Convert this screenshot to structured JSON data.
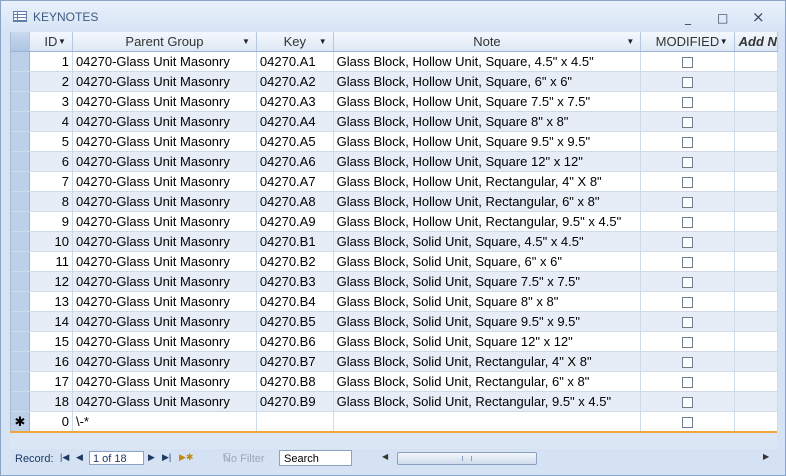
{
  "window": {
    "title": "KEYNOTES",
    "minimize": "_",
    "maximize": "□",
    "close": "×"
  },
  "columns": {
    "id": "ID",
    "parent_group": "Parent Group",
    "key": "Key",
    "note": "Note",
    "modified": "MODIFIED",
    "add": "Add N"
  },
  "rows": [
    {
      "id": "1",
      "group": "04270-Glass Unit Masonry",
      "key": "04270.A1",
      "note": "Glass Block, Hollow Unit, Square, 4.5\" x 4.5\""
    },
    {
      "id": "2",
      "group": "04270-Glass Unit Masonry",
      "key": "04270.A2",
      "note": "Glass Block, Hollow Unit, Square, 6\" x 6\""
    },
    {
      "id": "3",
      "group": "04270-Glass Unit Masonry",
      "key": "04270.A3",
      "note": "Glass Block, Hollow Unit, Square 7.5\" x 7.5\""
    },
    {
      "id": "4",
      "group": "04270-Glass Unit Masonry",
      "key": "04270.A4",
      "note": "Glass Block, Hollow Unit, Square 8\" x 8\""
    },
    {
      "id": "5",
      "group": "04270-Glass Unit Masonry",
      "key": "04270.A5",
      "note": "Glass Block, Hollow Unit, Square 9.5\" x 9.5\""
    },
    {
      "id": "6",
      "group": "04270-Glass Unit Masonry",
      "key": "04270.A6",
      "note": "Glass Block, Hollow Unit, Square 12\" x 12\""
    },
    {
      "id": "7",
      "group": "04270-Glass Unit Masonry",
      "key": "04270.A7",
      "note": "Glass Block, Hollow Unit, Rectangular, 4\" X 8\""
    },
    {
      "id": "8",
      "group": "04270-Glass Unit Masonry",
      "key": "04270.A8",
      "note": "Glass Block, Hollow Unit, Rectangular, 6\" x 8\""
    },
    {
      "id": "9",
      "group": "04270-Glass Unit Masonry",
      "key": "04270.A9",
      "note": "Glass Block, Hollow Unit, Rectangular, 9.5\" x 4.5\""
    },
    {
      "id": "10",
      "group": "04270-Glass Unit Masonry",
      "key": "04270.B1",
      "note": "Glass Block, Solid Unit, Square, 4.5\" x 4.5\""
    },
    {
      "id": "11",
      "group": "04270-Glass Unit Masonry",
      "key": "04270.B2",
      "note": "Glass Block, Solid Unit, Square, 6\" x 6\""
    },
    {
      "id": "12",
      "group": "04270-Glass Unit Masonry",
      "key": "04270.B3",
      "note": "Glass Block, Solid Unit, Square 7.5\" x 7.5\""
    },
    {
      "id": "13",
      "group": "04270-Glass Unit Masonry",
      "key": "04270.B4",
      "note": "Glass Block, Solid Unit, Square 8\" x 8\""
    },
    {
      "id": "14",
      "group": "04270-Glass Unit Masonry",
      "key": "04270.B5",
      "note": "Glass Block, Solid Unit, Square 9.5\" x 9.5\""
    },
    {
      "id": "15",
      "group": "04270-Glass Unit Masonry",
      "key": "04270.B6",
      "note": "Glass Block, Solid Unit, Square 12\" x 12\""
    },
    {
      "id": "16",
      "group": "04270-Glass Unit Masonry",
      "key": "04270.B7",
      "note": "Glass Block, Solid Unit, Rectangular, 4\" X 8\""
    },
    {
      "id": "17",
      "group": "04270-Glass Unit Masonry",
      "key": "04270.B8",
      "note": "Glass Block, Solid Unit, Rectangular, 6\" x 8\""
    },
    {
      "id": "18",
      "group": "04270-Glass Unit Masonry",
      "key": "04270.B9",
      "note": "Glass Block, Solid Unit, Rectangular, 9.5\" x 4.5\""
    }
  ],
  "new_row": {
    "marker": "✱",
    "id": "0",
    "group": "\\-*"
  },
  "navigation": {
    "record_label": "Record:",
    "first": "|◀",
    "prev": "◀",
    "record_position": "1 of 18",
    "next": "▶",
    "last": "▶|",
    "new": "▶✱",
    "filter_label": "No Filter",
    "search_label": "Search"
  }
}
